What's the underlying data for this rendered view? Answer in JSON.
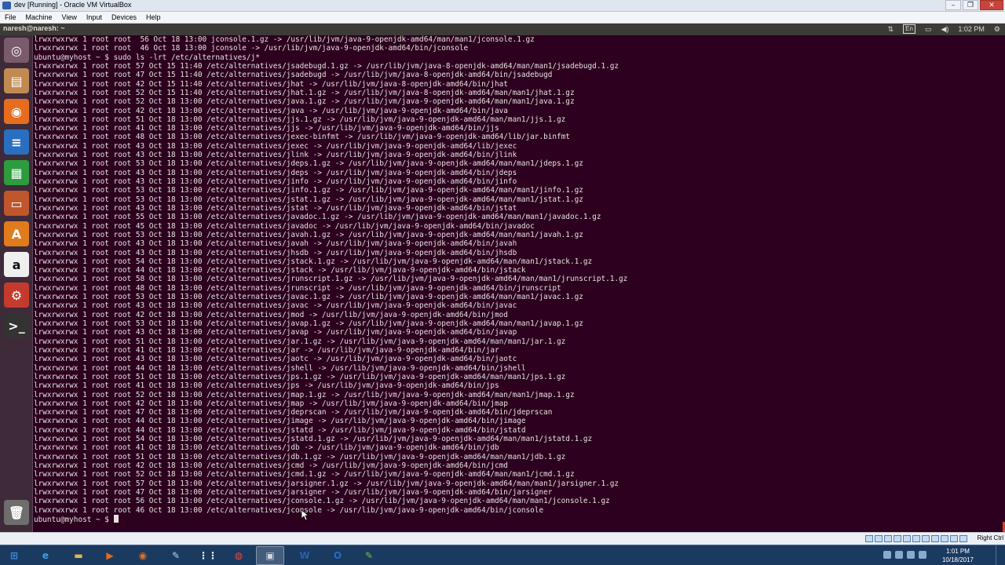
{
  "vbox": {
    "title": "dev [Running] - Oracle VM VirtualBox",
    "menus": [
      "File",
      "Machine",
      "View",
      "Input",
      "Devices",
      "Help"
    ],
    "host_key": "Right Ctrl"
  },
  "panel": {
    "window_title": "naresh@naresh: ~",
    "keyboard": "En",
    "time": "1:02 PM"
  },
  "launcher": [
    {
      "name": "dash-home-icon",
      "glyph": "◎",
      "color": "#7a5a6d"
    },
    {
      "name": "files-icon",
      "glyph": "▤",
      "color": "#c28a53"
    },
    {
      "name": "firefox-icon",
      "glyph": "◉",
      "color": "#e66d1f"
    },
    {
      "name": "writer-icon",
      "glyph": "≡",
      "color": "#2a6fbf"
    },
    {
      "name": "calc-icon",
      "glyph": "▦",
      "color": "#2e9b3e"
    },
    {
      "name": "impress-icon",
      "glyph": "▭",
      "color": "#c0562b"
    },
    {
      "name": "software-center-icon",
      "glyph": "A",
      "color": "#e07b1e"
    },
    {
      "name": "amazon-icon",
      "glyph": "a",
      "color": "#efefef"
    },
    {
      "name": "settings-icon",
      "glyph": "⚙",
      "color": "#c43b2d"
    },
    {
      "name": "terminal-icon",
      "glyph": ">_",
      "color": "#333333"
    },
    {
      "name": "trash-icon",
      "glyph": "🗑",
      "color": "#6e6e6e"
    }
  ],
  "terminal_lines": [
    "lrwxrwxrwx 1 root root  56 Oct 18 13:00 jconsole.1.gz -> /usr/lib/jvm/java-9-openjdk-amd64/man/man1/jconsole.1.gz",
    "lrwxrwxrwx 1 root root  46 Oct 18 13:00 jconsole -> /usr/lib/jvm/java-9-openjdk-amd64/bin/jconsole",
    "ubuntu@myhost ~ $ sudo ls -lrt /etc/alternatives/j*",
    "lrwxrwxrwx 1 root root 57 Oct 15 11:40 /etc/alternatives/jsadebugd.1.gz -> /usr/lib/jvm/java-8-openjdk-amd64/man/man1/jsadebugd.1.gz",
    "lrwxrwxrwx 1 root root 47 Oct 15 11:40 /etc/alternatives/jsadebugd -> /usr/lib/jvm/java-8-openjdk-amd64/bin/jsadebugd",
    "lrwxrwxrwx 1 root root 42 Oct 15 11:40 /etc/alternatives/jhat -> /usr/lib/jvm/java-8-openjdk-amd64/bin/jhat",
    "lrwxrwxrwx 1 root root 52 Oct 15 11:40 /etc/alternatives/jhat.1.gz -> /usr/lib/jvm/java-8-openjdk-amd64/man/man1/jhat.1.gz",
    "lrwxrwxrwx 1 root root 52 Oct 18 13:00 /etc/alternatives/java.1.gz -> /usr/lib/jvm/java-9-openjdk-amd64/man/man1/java.1.gz",
    "lrwxrwxrwx 1 root root 42 Oct 18 13:00 /etc/alternatives/java -> /usr/lib/jvm/java-9-openjdk-amd64/bin/java",
    "lrwxrwxrwx 1 root root 51 Oct 18 13:00 /etc/alternatives/jjs.1.gz -> /usr/lib/jvm/java-9-openjdk-amd64/man/man1/jjs.1.gz",
    "lrwxrwxrwx 1 root root 41 Oct 18 13:00 /etc/alternatives/jjs -> /usr/lib/jvm/java-9-openjdk-amd64/bin/jjs",
    "lrwxrwxrwx 1 root root 48 Oct 18 13:00 /etc/alternatives/jexec-binfmt -> /usr/lib/jvm/java-9-openjdk-amd64/lib/jar.binfmt",
    "lrwxrwxrwx 1 root root 43 Oct 18 13:00 /etc/alternatives/jexec -> /usr/lib/jvm/java-9-openjdk-amd64/lib/jexec",
    "lrwxrwxrwx 1 root root 43 Oct 18 13:00 /etc/alternatives/jlink -> /usr/lib/jvm/java-9-openjdk-amd64/bin/jlink",
    "lrwxrwxrwx 1 root root 53 Oct 18 13:00 /etc/alternatives/jdeps.1.gz -> /usr/lib/jvm/java-9-openjdk-amd64/man/man1/jdeps.1.gz",
    "lrwxrwxrwx 1 root root 43 Oct 18 13:00 /etc/alternatives/jdeps -> /usr/lib/jvm/java-9-openjdk-amd64/bin/jdeps",
    "lrwxrwxrwx 1 root root 43 Oct 18 13:00 /etc/alternatives/jinfo -> /usr/lib/jvm/java-9-openjdk-amd64/bin/jinfo",
    "lrwxrwxrwx 1 root root 53 Oct 18 13:00 /etc/alternatives/jinfo.1.gz -> /usr/lib/jvm/java-9-openjdk-amd64/man/man1/jinfo.1.gz",
    "lrwxrwxrwx 1 root root 53 Oct 18 13:00 /etc/alternatives/jstat.1.gz -> /usr/lib/jvm/java-9-openjdk-amd64/man/man1/jstat.1.gz",
    "lrwxrwxrwx 1 root root 43 Oct 18 13:00 /etc/alternatives/jstat -> /usr/lib/jvm/java-9-openjdk-amd64/bin/jstat",
    "lrwxrwxrwx 1 root root 55 Oct 18 13:00 /etc/alternatives/javadoc.1.gz -> /usr/lib/jvm/java-9-openjdk-amd64/man/man1/javadoc.1.gz",
    "lrwxrwxrwx 1 root root 45 Oct 18 13:00 /etc/alternatives/javadoc -> /usr/lib/jvm/java-9-openjdk-amd64/bin/javadoc",
    "lrwxrwxrwx 1 root root 53 Oct 18 13:00 /etc/alternatives/javah.1.gz -> /usr/lib/jvm/java-9-openjdk-amd64/man/man1/javah.1.gz",
    "lrwxrwxrwx 1 root root 43 Oct 18 13:00 /etc/alternatives/javah -> /usr/lib/jvm/java-9-openjdk-amd64/bin/javah",
    "lrwxrwxrwx 1 root root 43 Oct 18 13:00 /etc/alternatives/jhsdb -> /usr/lib/jvm/java-9-openjdk-amd64/bin/jhsdb",
    "lrwxrwxrwx 1 root root 54 Oct 18 13:00 /etc/alternatives/jstack.1.gz -> /usr/lib/jvm/java-9-openjdk-amd64/man/man1/jstack.1.gz",
    "lrwxrwxrwx 1 root root 44 Oct 18 13:00 /etc/alternatives/jstack -> /usr/lib/jvm/java-9-openjdk-amd64/bin/jstack",
    "lrwxrwxrwx 1 root root 58 Oct 18 13:00 /etc/alternatives/jrunscript.1.gz -> /usr/lib/jvm/java-9-openjdk-amd64/man/man1/jrunscript.1.gz",
    "lrwxrwxrwx 1 root root 48 Oct 18 13:00 /etc/alternatives/jrunscript -> /usr/lib/jvm/java-9-openjdk-amd64/bin/jrunscript",
    "lrwxrwxrwx 1 root root 53 Oct 18 13:00 /etc/alternatives/javac.1.gz -> /usr/lib/jvm/java-9-openjdk-amd64/man/man1/javac.1.gz",
    "lrwxrwxrwx 1 root root 43 Oct 18 13:00 /etc/alternatives/javac -> /usr/lib/jvm/java-9-openjdk-amd64/bin/javac",
    "lrwxrwxrwx 1 root root 42 Oct 18 13:00 /etc/alternatives/jmod -> /usr/lib/jvm/java-9-openjdk-amd64/bin/jmod",
    "lrwxrwxrwx 1 root root 53 Oct 18 13:00 /etc/alternatives/javap.1.gz -> /usr/lib/jvm/java-9-openjdk-amd64/man/man1/javap.1.gz",
    "lrwxrwxrwx 1 root root 43 Oct 18 13:00 /etc/alternatives/javap -> /usr/lib/jvm/java-9-openjdk-amd64/bin/javap",
    "lrwxrwxrwx 1 root root 51 Oct 18 13:00 /etc/alternatives/jar.1.gz -> /usr/lib/jvm/java-9-openjdk-amd64/man/man1/jar.1.gz",
    "lrwxrwxrwx 1 root root 41 Oct 18 13:00 /etc/alternatives/jar -> /usr/lib/jvm/java-9-openjdk-amd64/bin/jar",
    "lrwxrwxrwx 1 root root 43 Oct 18 13:00 /etc/alternatives/jaotc -> /usr/lib/jvm/java-9-openjdk-amd64/bin/jaotc",
    "lrwxrwxrwx 1 root root 44 Oct 18 13:00 /etc/alternatives/jshell -> /usr/lib/jvm/java-9-openjdk-amd64/bin/jshell",
    "lrwxrwxrwx 1 root root 51 Oct 18 13:00 /etc/alternatives/jps.1.gz -> /usr/lib/jvm/java-9-openjdk-amd64/man/man1/jps.1.gz",
    "lrwxrwxrwx 1 root root 41 Oct 18 13:00 /etc/alternatives/jps -> /usr/lib/jvm/java-9-openjdk-amd64/bin/jps",
    "lrwxrwxrwx 1 root root 52 Oct 18 13:00 /etc/alternatives/jmap.1.gz -> /usr/lib/jvm/java-9-openjdk-amd64/man/man1/jmap.1.gz",
    "lrwxrwxrwx 1 root root 42 Oct 18 13:00 /etc/alternatives/jmap -> /usr/lib/jvm/java-9-openjdk-amd64/bin/jmap",
    "lrwxrwxrwx 1 root root 47 Oct 18 13:00 /etc/alternatives/jdeprscan -> /usr/lib/jvm/java-9-openjdk-amd64/bin/jdeprscan",
    "lrwxrwxrwx 1 root root 44 Oct 18 13:00 /etc/alternatives/jimage -> /usr/lib/jvm/java-9-openjdk-amd64/bin/jimage",
    "lrwxrwxrwx 1 root root 44 Oct 18 13:00 /etc/alternatives/jstatd -> /usr/lib/jvm/java-9-openjdk-amd64/bin/jstatd",
    "lrwxrwxrwx 1 root root 54 Oct 18 13:00 /etc/alternatives/jstatd.1.gz -> /usr/lib/jvm/java-9-openjdk-amd64/man/man1/jstatd.1.gz",
    "lrwxrwxrwx 1 root root 41 Oct 18 13:00 /etc/alternatives/jdb -> /usr/lib/jvm/java-9-openjdk-amd64/bin/jdb",
    "lrwxrwxrwx 1 root root 51 Oct 18 13:00 /etc/alternatives/jdb.1.gz -> /usr/lib/jvm/java-9-openjdk-amd64/man/man1/jdb.1.gz",
    "lrwxrwxrwx 1 root root 42 Oct 18 13:00 /etc/alternatives/jcmd -> /usr/lib/jvm/java-9-openjdk-amd64/bin/jcmd",
    "lrwxrwxrwx 1 root root 52 Oct 18 13:00 /etc/alternatives/jcmd.1.gz -> /usr/lib/jvm/java-9-openjdk-amd64/man/man1/jcmd.1.gz",
    "lrwxrwxrwx 1 root root 57 Oct 18 13:00 /etc/alternatives/jarsigner.1.gz -> /usr/lib/jvm/java-9-openjdk-amd64/man/man1/jarsigner.1.gz",
    "lrwxrwxrwx 1 root root 47 Oct 18 13:00 /etc/alternatives/jarsigner -> /usr/lib/jvm/java-9-openjdk-amd64/bin/jarsigner",
    "lrwxrwxrwx 1 root root 56 Oct 18 13:00 /etc/alternatives/jconsole.1.gz -> /usr/lib/jvm/java-9-openjdk-amd64/man/man1/jconsole.1.gz",
    "lrwxrwxrwx 1 root root 46 Oct 18 13:00 /etc/alternatives/jconsole -> /usr/lib/jvm/java-9-openjdk-amd64/bin/jconsole"
  ],
  "prompt": "ubuntu@myhost ~ $ ",
  "taskbar": {
    "apps": [
      {
        "name": "start-button",
        "glyph": "⊞",
        "color": "#3b8ee0"
      },
      {
        "name": "internet-explorer-icon",
        "glyph": "e",
        "color": "#3aa0e8"
      },
      {
        "name": "file-explorer-icon",
        "glyph": "▬",
        "color": "#e8b84a"
      },
      {
        "name": "media-player-icon",
        "glyph": "▶",
        "color": "#e46a1f"
      },
      {
        "name": "firefox-taskbar-icon",
        "glyph": "◉",
        "color": "#e66d1f"
      },
      {
        "name": "tools-icon",
        "glyph": "✎",
        "color": "#b8d3ef"
      },
      {
        "name": "apps-grid-icon",
        "glyph": "⋮⋮",
        "color": "#ffffff"
      },
      {
        "name": "chrome-icon",
        "glyph": "◍",
        "color": "#e9493c"
      },
      {
        "name": "virtualbox-taskbar-icon",
        "glyph": "▣",
        "color": "#cfd6de"
      },
      {
        "name": "word-icon",
        "glyph": "W",
        "color": "#2b5fad"
      },
      {
        "name": "outlook-icon",
        "glyph": "O",
        "color": "#1f6fc5"
      },
      {
        "name": "notepad-icon",
        "glyph": "✎",
        "color": "#7cc242"
      }
    ],
    "time": "1:01 PM",
    "date": "10/18/2017"
  }
}
